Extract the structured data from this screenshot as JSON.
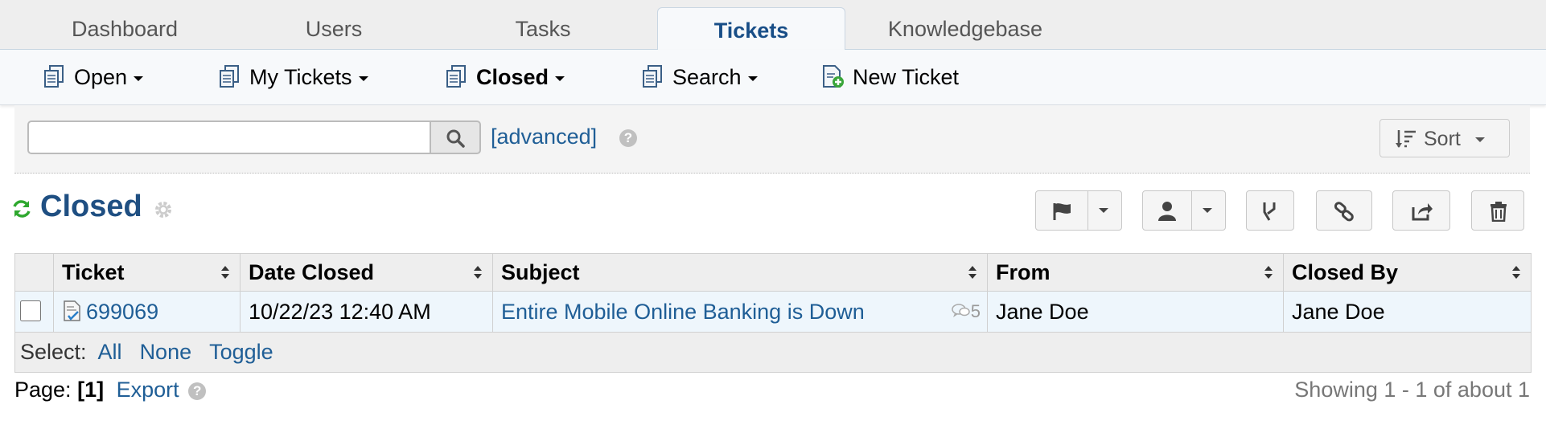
{
  "tabs": [
    "Dashboard",
    "Users",
    "Tasks",
    "Tickets",
    "Knowledgebase"
  ],
  "active_tab": "Tickets",
  "subnav": {
    "open": "Open",
    "my_tickets": "My Tickets",
    "closed": "Closed",
    "search": "Search",
    "new_ticket": "New Ticket"
  },
  "search": {
    "value": "",
    "placeholder": "",
    "advanced": "[advanced]"
  },
  "sort": {
    "label": "Sort"
  },
  "queue": {
    "title": "Closed"
  },
  "table": {
    "columns": [
      "Ticket",
      "Date Closed",
      "Subject",
      "From",
      "Closed By"
    ],
    "rows": [
      {
        "ticket": "699069",
        "date_closed": "10/22/23 12:40 AM",
        "subject": "Entire Mobile Online Banking is Down",
        "thread_count": "5",
        "from": "Jane Doe",
        "closed_by": "Jane Doe"
      }
    ],
    "select_label": "Select:",
    "select_all": "All",
    "select_none": "None",
    "select_toggle": "Toggle"
  },
  "footer": {
    "page_label": "Page:",
    "page_current": "[1]",
    "export": "Export",
    "showing": "Showing 1 - 1 of about 1"
  },
  "colors": {
    "accent": "#1f4f82",
    "link": "#1f5e96",
    "refresh": "#2ea82e"
  }
}
